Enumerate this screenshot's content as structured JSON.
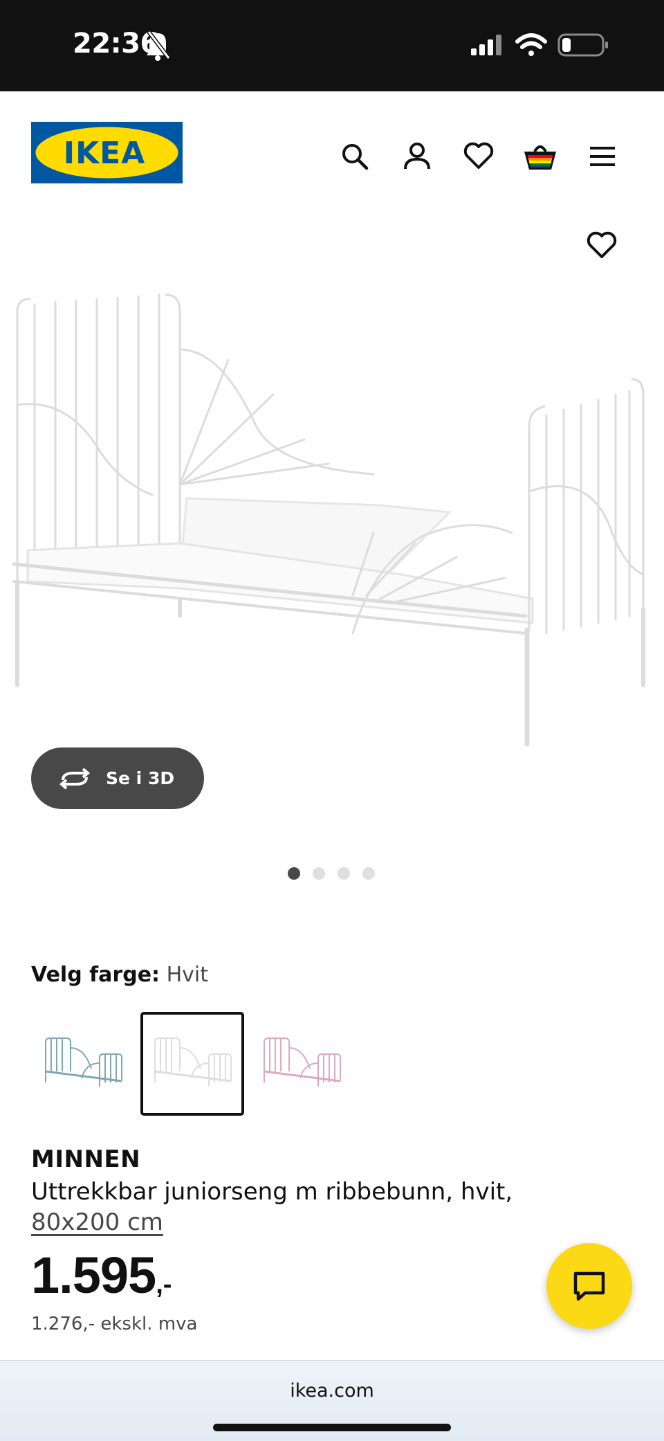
{
  "status_bar": {
    "time": "22:36",
    "icons": [
      "bell-slash-icon",
      "cellular-signal-icon",
      "wifi-icon",
      "battery-icon"
    ]
  },
  "header": {
    "logo_text": "IKEA",
    "logo_colors": {
      "background": "#0058A3",
      "text": "#FFDB00"
    },
    "icons": [
      "search-icon",
      "account-icon",
      "heart-icon",
      "shopping-bag-icon",
      "menu-icon"
    ]
  },
  "gallery": {
    "view_3d_label": "Se i 3D",
    "image_count": 4,
    "active_image": 1
  },
  "color_selector": {
    "label": "Velg farge:",
    "selected_value": "Hvit",
    "options": [
      {
        "color": "#7fa8b3",
        "selected": false
      },
      {
        "color": "#e8e8e8",
        "selected": true
      },
      {
        "color": "#dca9bd",
        "selected": false
      }
    ]
  },
  "product": {
    "name": "MINNEN",
    "description": "Uttrekkbar juniorseng m ribbebunn, hvit,",
    "size_link": "80x200 cm",
    "price_main": "1.595",
    "price_suffix": ",-",
    "price_excl_vat": "1.276,- ekskl. mva"
  },
  "chat": {
    "icon": "chat-icon",
    "color": "#FBD914"
  },
  "browser": {
    "url": "ikea.com"
  }
}
